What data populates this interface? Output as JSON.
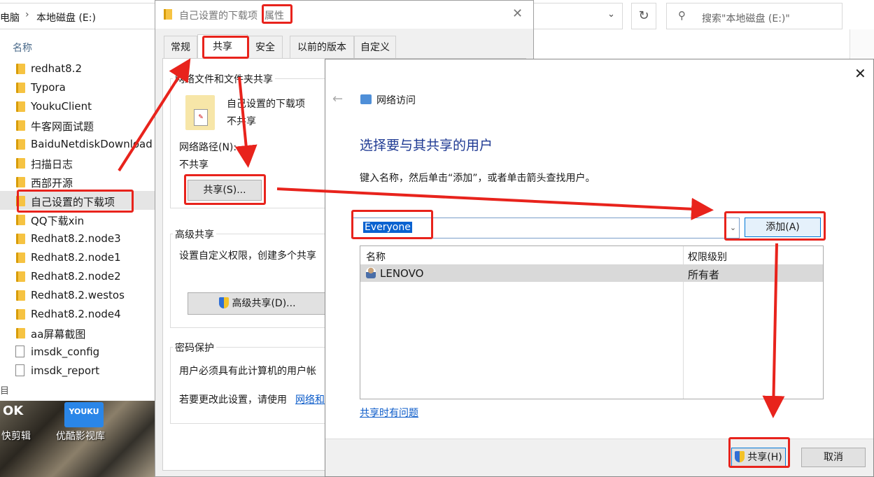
{
  "explorer": {
    "breadcrumb": [
      "电脑",
      "本地磁盘 (E:)"
    ],
    "search_placeholder": "搜索\"本地磁盘 (E:)\"",
    "column_name": "名称",
    "items": [
      {
        "name": "redhat8.2",
        "type": "folder"
      },
      {
        "name": "Typora",
        "type": "folder"
      },
      {
        "name": "YoukuClient",
        "type": "folder"
      },
      {
        "name": "牛客网面试题",
        "type": "folder"
      },
      {
        "name": "BaiduNetdiskDownload",
        "type": "folder"
      },
      {
        "name": "扫描日志",
        "type": "folder"
      },
      {
        "name": "西部开源",
        "type": "folder"
      },
      {
        "name": "自己设置的下载项",
        "type": "folder",
        "selected": true
      },
      {
        "name": "QQ下载xin",
        "type": "folder"
      },
      {
        "name": "Redhat8.2.node3",
        "type": "folder"
      },
      {
        "name": "Redhat8.2.node1",
        "type": "folder"
      },
      {
        "name": "Redhat8.2.node2",
        "type": "folder"
      },
      {
        "name": "Redhat8.2.westos",
        "type": "folder"
      },
      {
        "name": "Redhat8.2.node4",
        "type": "folder"
      },
      {
        "name": "aa屏幕截图",
        "type": "folder"
      },
      {
        "name": "imsdk_config",
        "type": "file"
      },
      {
        "name": "imsdk_report",
        "type": "file"
      }
    ],
    "desktop_icons": [
      "快剪辑",
      "优酷影视库"
    ],
    "youku_logo": "YOUKU",
    "left_fragment": "目"
  },
  "properties": {
    "title_name": "自己设置的下载项",
    "title_suffix": "属性",
    "tabs": [
      "常规",
      "共享",
      "安全",
      "以前的版本",
      "自定义"
    ],
    "active_tab": "共享",
    "network_sharing": {
      "heading": "网络文件和文件夹共享",
      "folder_name": "自己设置的下载项",
      "folder_status": "不共享",
      "path_label": "网络路径(N):",
      "path_value": "不共享",
      "share_button": "共享(S)..."
    },
    "advanced_sharing": {
      "heading": "高级共享",
      "description": "设置自定义权限，创建多个共享",
      "button": "高级共享(D)..."
    },
    "password": {
      "heading": "密码保护",
      "line1": "用户必须具有此计算机的用户帐",
      "line2_prefix": "若要更改此设置，请使用",
      "link": "网络和"
    }
  },
  "network_access": {
    "title": "网络访问",
    "heading": "选择要与其共享的用户",
    "instruction": "键入名称，然后单击“添加”，或者单击箭头查找用户。",
    "input_value": "Everyone",
    "add_button": "添加(A)",
    "table_headers": [
      "名称",
      "权限级别"
    ],
    "rows": [
      {
        "name": "LENOVO",
        "level": "所有者"
      }
    ],
    "help_link": "共享时有问题",
    "share_button": "共享(H)",
    "cancel_button": "取消"
  },
  "colors": {
    "annotation_red": "#e8231c",
    "heading_blue": "#1f3a93",
    "link_blue": "#0b5bc9",
    "selection_blue": "#0a62d0"
  }
}
